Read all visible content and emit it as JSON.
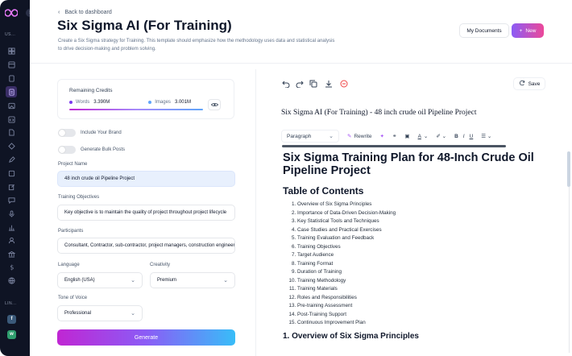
{
  "sidebar": {
    "sections": [
      "US...",
      "LIN..."
    ],
    "icons": [
      "grid-icon",
      "layout-icon",
      "file-icon",
      "doc-icon",
      "doc-active-icon",
      "image-icon",
      "code-icon",
      "file-text-icon",
      "grid2-icon",
      "pen-icon",
      "layers-icon",
      "chat-icon",
      "mic-icon",
      "chart-icon",
      "user-icon",
      "bank-icon",
      "dollar-icon",
      "globe-icon"
    ],
    "bottom_badges": [
      {
        "letter": "f",
        "color": "#3b5a7a"
      },
      {
        "letter": "w",
        "color": "#2f9e6e"
      }
    ]
  },
  "header": {
    "back_label": "Back to dashboard",
    "title": "Six Sigma AI (For Training)",
    "description": "Create a Six Sigma strategy for Training. This template should emphasize how the methodology uses data and statistical analysis to drive decision-making and problem solving.",
    "my_documents": "My Documents",
    "new_label": "New"
  },
  "credits": {
    "label": "Remaining Credits",
    "words_label": "Words",
    "words_value": "3.390M",
    "images_label": "Images",
    "images_value": "3.001M",
    "words_color": "#7c3aed",
    "images_color": "#60a5fa"
  },
  "form": {
    "include_brand": "Include Your Brand",
    "bulk_posts": "Generate Bulk Posts",
    "project_name_label": "Project Name",
    "project_name_value": "48 inch crude oil Pipeline Project",
    "objectives_label": "Training Objectives",
    "objectives_value": "Key objective is to maintain the quality of project throughout project lifecycle",
    "participants_label": "Participants",
    "participants_value": "Consultant, Contractor, sub-contractor, project managers, construction engineers",
    "language_label": "Language",
    "language_value": "English (USA)",
    "creativity_label": "Creativity",
    "creativity_value": "Premium",
    "tone_label": "Tone of Voice",
    "tone_value": "Professional",
    "generate_label": "Generate"
  },
  "editor": {
    "save_label": "Save",
    "doc_title": "Six Sigma AI (For Training) - 48 inch crude oil Pipeline Project",
    "paragraph_label": "Paragraph",
    "rewrite_label": "Rewrite",
    "heading": "Six Sigma Training Plan for 48-Inch Crude Oil Pipeline Project",
    "toc_heading": "Table of Contents",
    "toc": [
      "Overview of Six Sigma Principles",
      "Importance of Data-Driven Decision-Making",
      "Key Statistical Tools and Techniques",
      "Case Studies and Practical Exercises",
      "Training Evaluation and Feedback",
      "Training Objectives",
      "Target Audience",
      "Training Format",
      "Duration of Training",
      "Training Methodology",
      "Training Materials",
      "Roles and Responsibilities",
      "Pre-training Assessment",
      "Post-Training Support",
      "Continuous Improvement Plan"
    ],
    "section1": "1. Overview of Six Sigma Principles"
  }
}
